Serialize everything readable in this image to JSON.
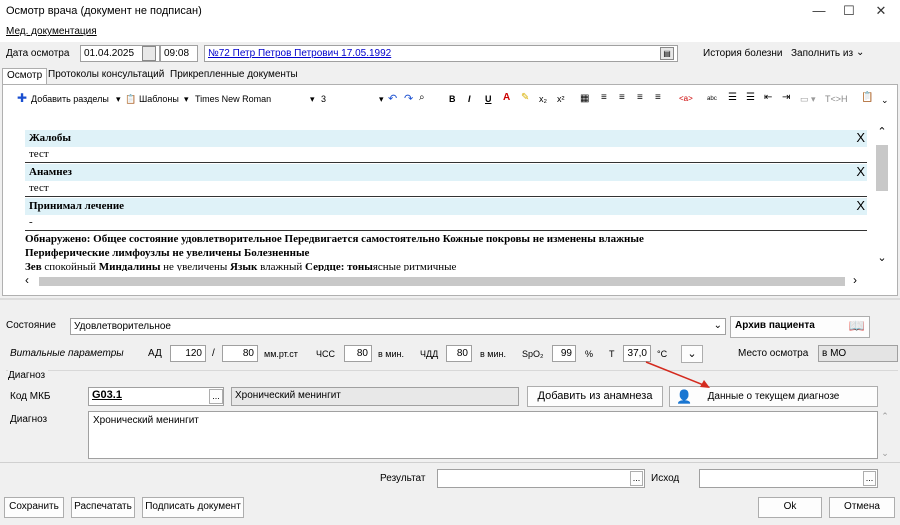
{
  "window": {
    "title": "Осмотр врача (документ не подписан)",
    "minimize": "—",
    "maximize": "☐",
    "close": "✕"
  },
  "menu": {
    "item": "Мед. документация"
  },
  "header": {
    "date_label": "Дата осмотра",
    "date_value": "01.04.2025",
    "time_value": "09:08",
    "patient_link": "№72 Петр Петров Петрович 17.05.1992",
    "history": "История болезни",
    "fill_from": "Заполнить из"
  },
  "tabs": [
    "Осмотр",
    "Протоколы консультаций",
    "Прикрепленные документы"
  ],
  "toolbar": {
    "add_sections": "Добавить разделы",
    "templates": "Шаблоны",
    "font": "Times New Roman",
    "size": "3",
    "bold": "B",
    "italic": "I",
    "underline": "U",
    "tag": "T<>H"
  },
  "document": {
    "sections": [
      {
        "title": "Жалобы",
        "body": "тест"
      },
      {
        "title": "Анамнез",
        "body": "тест"
      },
      {
        "title": "Принимал лечение",
        "body": "-"
      }
    ],
    "close_mark": "X",
    "line1": "Обнаружено: Общее состояние удовлетворительное Передвигается самостоятельно Кожные покровы не изменены влажные",
    "line2": "Периферические лимфоузлы не увеличены Болезненные",
    "line3_parts": [
      "Зев",
      " спокойный ",
      "Миндалины",
      " не увеличены ",
      "Язык",
      " влажный ",
      "Сердце: тоны",
      "ясные ритмичные"
    ]
  },
  "form": {
    "state_label": "Состояние",
    "state_value": "Удовлетворительное",
    "archive": "Архив пациента",
    "vitals_label": "Витальные параметры",
    "ad_label": "АД",
    "ad_sys": "120",
    "slash": "/",
    "ad_dia": "80",
    "ad_unit": "мм.рт.ст",
    "hr_label": "ЧСС",
    "hr": "80",
    "per_min": "в мин.",
    "rr_label": "ЧДД",
    "rr": "80",
    "per_min2": "в мин.",
    "spo2_label": "SpO₂",
    "spo2": "99",
    "pct": "%",
    "t_label": "Т",
    "t": "37,0",
    "t_unit": "°C",
    "place_label": "Место осмотра",
    "place_value": "в МО",
    "diag_group": "Диагноз",
    "mkb_label": "Код МКБ",
    "mkb_code": "G03.1",
    "mkb_name": "Хронический менингит",
    "add_from_anamnesis": "Добавить из анамнеза",
    "current_diag": "Данные о текущем диагнозе",
    "diag_label": "Диагноз",
    "diag_text": "Хронический менингит",
    "result_label": "Результат",
    "outcome_label": "Исход",
    "ellipsis": "..."
  },
  "footer": {
    "save": "Сохранить",
    "print": "Распечатать",
    "sign": "Подписать документ",
    "ok": "Ok",
    "cancel": "Отмена"
  }
}
